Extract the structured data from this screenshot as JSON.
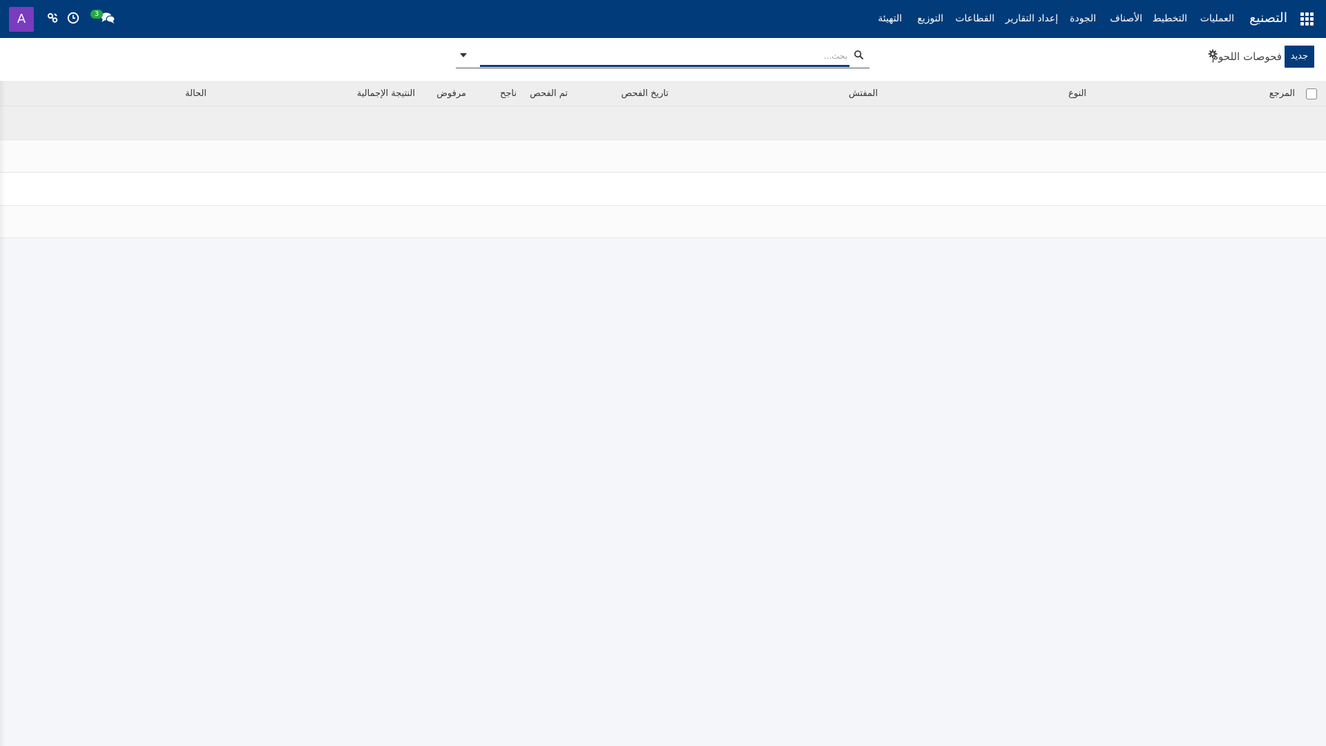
{
  "navbar": {
    "app_title": "التصنيع",
    "menu": [
      "العمليات",
      "التخطيط",
      "الأصناف",
      "الجودة",
      "إعداد التقارير",
      "القطاعات",
      "التوزيع",
      "التهيئة"
    ],
    "chat_badge": "3",
    "avatar_letter": "A"
  },
  "control_panel": {
    "new_button": "جديد",
    "breadcrumb": "فحوصات اللحوم",
    "search_placeholder": "بحث..."
  },
  "table": {
    "columns": [
      "المرجع",
      "النوع",
      "المفتش",
      "تاريخ الفحص",
      "تم الفحص",
      "ناجح",
      "مرفوض",
      "النتيجة الإجمالية",
      "الحالة"
    ]
  },
  "colors": {
    "navbar": "#013b7a",
    "primary_button": "#013b7a",
    "avatar": "#7a3bbd",
    "badge": "#28a745",
    "background": "#f4f6f9"
  },
  "icons": [
    "apps-grid-icon",
    "chat-icon",
    "clock-icon",
    "tools-icon",
    "gear-icon",
    "search-icon",
    "caret-down-icon"
  ]
}
